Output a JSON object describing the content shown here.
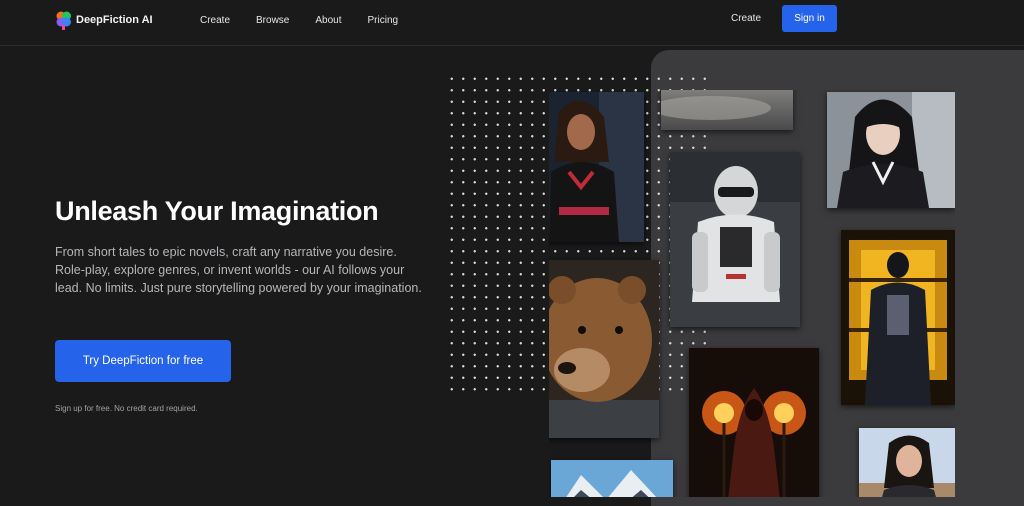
{
  "brand": {
    "name": "DeepFiction AI",
    "logo_icon": "brain-logo-icon"
  },
  "nav": {
    "links": [
      "Create",
      "Browse",
      "About",
      "Pricing"
    ],
    "create_label": "Create",
    "signin_label": "Sign in"
  },
  "hero": {
    "title": "Unleash Your Imagination",
    "description": "From short tales to epic novels, craft any narrative you desire. Role-play, explore genres, or invent worlds - our AI follows your lead. No limits. Just pure storytelling powered by your imagination.",
    "cta_label": "Try DeepFiction for free",
    "note": "Sign up for free. No credit card required."
  },
  "colors": {
    "background": "#1a1a1b",
    "accent": "#2563eb",
    "panel": "#3b3b3d"
  },
  "gallery": [
    "woman-portrait-image",
    "cloudy-sky-image",
    "anime-girl-image",
    "armored-soldier-image",
    "dark-knight-image",
    "bear-image",
    "fire-sorcerer-image",
    "mountain-snow-image",
    "woman-selfie-image"
  ]
}
